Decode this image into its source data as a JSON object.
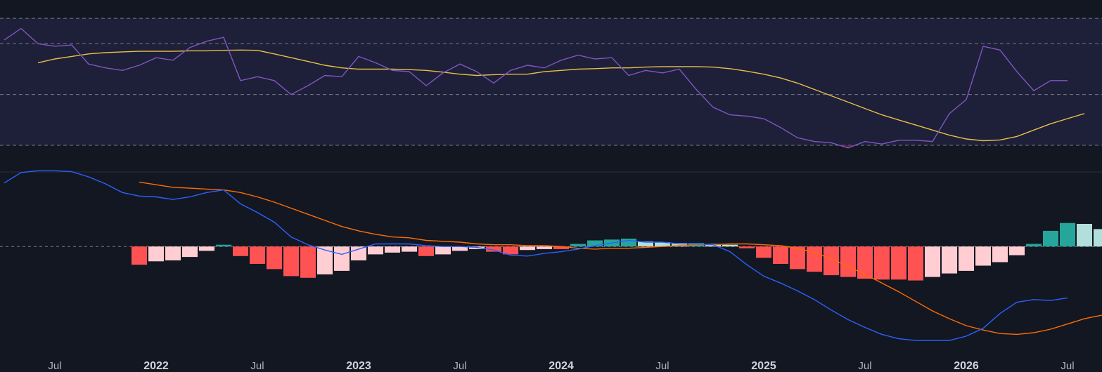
{
  "colors": {
    "background": "#131722",
    "rsi_band": "#1e1f38",
    "rsi_line": "#7e57c2",
    "rsi_ma": "#e6c04a",
    "rsi_oversold_fill": "#7a1f3d",
    "band_line": "#787b86",
    "pane_divider": "#2a2e39",
    "macd_line": "#2962ff",
    "signal_line": "#ff6d00",
    "hist_pos_strong": "#26a69a",
    "hist_pos_weak": "#b2dfdb",
    "hist_neg_strong": "#ff5252",
    "hist_neg_weak": "#ffcdd2",
    "axis_text": "#b2b5be"
  },
  "chart_data": [
    {
      "type": "line",
      "pane": "RSI",
      "x_range": [
        0,
        64
      ],
      "ylim": [
        22,
        85
      ],
      "bands": [
        80,
        70,
        50,
        30
      ],
      "grid": false,
      "series": [
        {
          "key": "rsi",
          "start_index": 0,
          "values": [
            71.5,
            76,
            70,
            69,
            69.5,
            62,
            60.5,
            59.5,
            61.5,
            64.5,
            63.5,
            68.5,
            71,
            72.5,
            55.5,
            57,
            55.5,
            50,
            53.5,
            57.5,
            57,
            65,
            62.5,
            59.5,
            59,
            53.5,
            58.5,
            62,
            59,
            54.5,
            59.5,
            61.5,
            60.5,
            63.5,
            65.5,
            64,
            64.5,
            57.5,
            59.5,
            58.5,
            60,
            52,
            45,
            42,
            41.5,
            40.5,
            37,
            33,
            31.5,
            31,
            29,
            31.5,
            30.5,
            32,
            32,
            31.5,
            42.5,
            48,
            69,
            67.5,
            59,
            51.5,
            55.5,
            55.5
          ]
        },
        {
          "key": "rsi_ma",
          "start_index": 2,
          "values": [
            62.5,
            64,
            65,
            66,
            66.5,
            66.8,
            67,
            67,
            67,
            67.2,
            67.2,
            67.4,
            67.5,
            67.4,
            66,
            64.5,
            63,
            61.5,
            60.5,
            60,
            60,
            60,
            59.8,
            59.5,
            58.8,
            58,
            57.5,
            57.8,
            58,
            58,
            59,
            59.5,
            60,
            60.2,
            60.5,
            60.5,
            60.8,
            61,
            61,
            61,
            60.8,
            60.2,
            59.2,
            58,
            56.5,
            54.5,
            52,
            49.5,
            47,
            44.5,
            42,
            40,
            38,
            36,
            34,
            32.5,
            31.8,
            32.1,
            33.5,
            36,
            38.5,
            40.5,
            42.5
          ]
        }
      ]
    },
    {
      "type": "bar",
      "pane": "MACD",
      "x_range": [
        0,
        64
      ],
      "ylim": [
        -1.2,
        0.8
      ],
      "zero_line": true,
      "grid": false,
      "series": [
        {
          "key": "macd",
          "start_index": 0,
          "values": [
            0.73,
            0.85,
            0.87,
            0.87,
            0.86,
            0.8,
            0.72,
            0.62,
            0.58,
            0.57,
            0.54,
            0.57,
            0.62,
            0.65,
            0.49,
            0.39,
            0.28,
            0.11,
            0.02,
            -0.04,
            -0.09,
            -0.03,
            0.03,
            0.03,
            0.03,
            0.01,
            0,
            0,
            -0.01,
            -0.04,
            -0.1,
            -0.11,
            -0.08,
            -0.06,
            -0.03,
            0.01,
            0.04,
            0.07,
            0.05,
            0.05,
            0.03,
            0.03,
            0.02,
            -0.06,
            -0.21,
            -0.34,
            -0.42,
            -0.51,
            -0.61,
            -0.73,
            -0.84,
            -0.93,
            -1.01,
            -1.06,
            -1.08,
            -1.08,
            -1.08,
            -1.03,
            -0.94,
            -0.77,
            -0.64,
            -0.61,
            -0.62,
            -0.59
          ]
        },
        {
          "key": "signal",
          "start_index": 8,
          "values": [
            0.74,
            0.71,
            0.68,
            0.67,
            0.66,
            0.65,
            0.62,
            0.57,
            0.51,
            0.44,
            0.37,
            0.3,
            0.23,
            0.18,
            0.14,
            0.11,
            0.1,
            0.07,
            0.06,
            0.05,
            0.03,
            0.02,
            0.02,
            0.01,
            0.01,
            0,
            -0.02,
            -0.03,
            -0.02,
            -0.02,
            -0.01,
            0,
            0.01,
            0.02,
            0.02,
            0.03,
            0.03,
            0.02,
            0.01,
            -0.02,
            -0.07,
            -0.14,
            -0.23,
            -0.32,
            -0.42,
            -0.52,
            -0.63,
            -0.74,
            -0.83,
            -0.91,
            -0.96,
            -1,
            -1.01,
            -0.99,
            -0.95,
            -0.89,
            -0.83,
            -0.79,
            -0.76,
            -0.72
          ]
        },
        {
          "key": "histogram",
          "start_index": 8,
          "values": [
            -0.21,
            -0.17,
            -0.16,
            -0.12,
            -0.05,
            0.02,
            -0.11,
            -0.2,
            -0.26,
            -0.34,
            -0.36,
            -0.32,
            -0.28,
            -0.16,
            -0.09,
            -0.07,
            -0.06,
            -0.11,
            -0.09,
            -0.05,
            -0.03,
            -0.06,
            -0.09,
            -0.04,
            -0.03,
            -0.03,
            0.03,
            0.07,
            0.08,
            0.09,
            0.06,
            0.05,
            0.04,
            0.04,
            0.03,
            0.02,
            -0.02,
            -0.13,
            -0.2,
            -0.26,
            -0.29,
            -0.33,
            -0.35,
            -0.37,
            -0.38,
            -0.38,
            -0.39,
            -0.35,
            -0.31,
            -0.28,
            -0.22,
            -0.18,
            -0.1,
            0.03,
            0.18,
            0.27,
            0.26,
            0.2,
            0.17,
            0.16
          ]
        }
      ]
    }
  ],
  "x_axis": {
    "ticks": [
      {
        "label": "Jul",
        "index": 3,
        "year": false
      },
      {
        "label": "2022",
        "index": 9,
        "year": true
      },
      {
        "label": "Jul",
        "index": 15,
        "year": false
      },
      {
        "label": "2023",
        "index": 21,
        "year": true
      },
      {
        "label": "Jul",
        "index": 27,
        "year": false
      },
      {
        "label": "2024",
        "index": 33,
        "year": true
      },
      {
        "label": "Jul",
        "index": 39,
        "year": false
      },
      {
        "label": "2025",
        "index": 45,
        "year": true
      },
      {
        "label": "Jul",
        "index": 51,
        "year": false
      },
      {
        "label": "2026",
        "index": 57,
        "year": true
      },
      {
        "label": "Jul",
        "index": 63,
        "year": false
      }
    ]
  }
}
